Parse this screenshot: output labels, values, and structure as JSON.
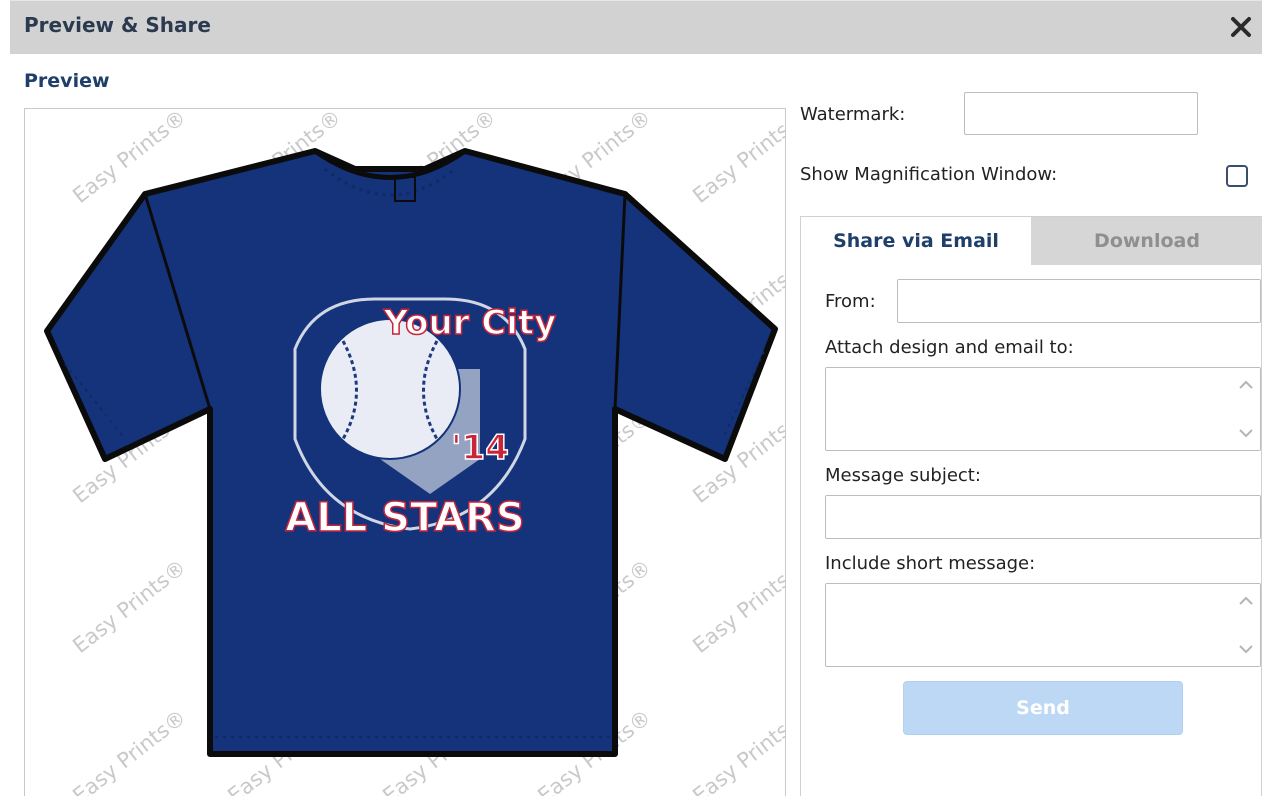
{
  "dialog": {
    "title": "Preview & Share",
    "close_icon": "close-icon"
  },
  "preview": {
    "section_title": "Preview",
    "watermark_text": "Easy Prints®",
    "design": {
      "line1": "Your City",
      "line2": "'14",
      "line3": "ALL STARS"
    },
    "colors": {
      "shirt": "#14337a",
      "accent": "#c8243a",
      "print": "#ffffff"
    }
  },
  "options": {
    "watermark_label": "Watermark:",
    "watermark_value": "",
    "magnification_label": "Show Magnification Window:",
    "magnification_checked": false
  },
  "share": {
    "tabs": [
      {
        "label": "Share via Email",
        "active": true
      },
      {
        "label": "Download",
        "active": false
      }
    ],
    "from_label": "From:",
    "from_value": "",
    "attach_label": "Attach design and email to:",
    "attach_value": "",
    "subject_label": "Message subject:",
    "subject_value": "",
    "message_label": "Include short message:",
    "message_value": "",
    "send_label": "Send"
  }
}
